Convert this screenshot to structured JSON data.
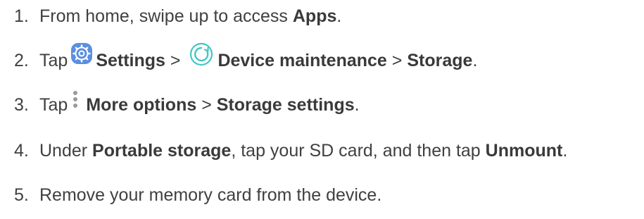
{
  "steps": [
    {
      "number": "1.",
      "text_before": "From home, swipe up to access ",
      "bold_1": "Apps",
      "text_after": "."
    },
    {
      "number": "2.",
      "tap": "Tap",
      "settings_icon": "settings-gear-icon",
      "bold_settings": "Settings",
      "sep_1": " > ",
      "maintenance_icon": "device-maintenance-icon",
      "bold_device_maintenance": "Device maintenance",
      "sep_2": " > ",
      "bold_storage": "Storage",
      "end": "."
    },
    {
      "number": "3.",
      "tap": "Tap",
      "more_icon": "more-options-icon",
      "bold_more_options": "More options",
      "sep": " > ",
      "bold_storage_settings": "Storage settings",
      "end": "."
    },
    {
      "number": "4.",
      "text_before": "Under ",
      "bold_portable_storage": "Portable storage",
      "text_middle": ", tap your SD card, and then tap ",
      "bold_unmount": "Unmount",
      "end": "."
    },
    {
      "number": "5.",
      "text": "Remove your memory card from the device."
    }
  ],
  "colors": {
    "text": "#404040",
    "settings_icon_bg": "#5b8fe0",
    "maintenance_icon": "#43c7c1",
    "more_dots": "#9a9a9a"
  }
}
